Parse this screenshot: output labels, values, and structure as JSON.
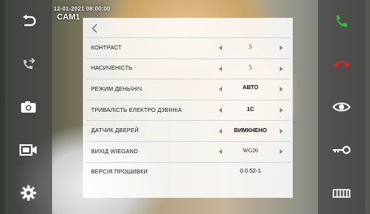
{
  "overlay": {
    "datetime": "12-01-2021  08:00:00",
    "camera": "CAM1"
  },
  "left_panel": {
    "buttons": [
      {
        "icon": "back-arrow-icon"
      },
      {
        "icon": "call-transfer-icon"
      },
      {
        "icon": "camera-icon"
      },
      {
        "icon": "record-icon"
      },
      {
        "icon": "settings-gear-icon"
      }
    ]
  },
  "right_panel": {
    "buttons": [
      {
        "icon": "answer-call-icon",
        "color": "#2fbf3a"
      },
      {
        "icon": "hang-up-icon",
        "color": "#e02020"
      },
      {
        "icon": "monitor-eye-icon"
      },
      {
        "icon": "unlock-key-icon"
      },
      {
        "icon": "gate-icon"
      }
    ]
  },
  "settings": {
    "rows": [
      {
        "label": "КОНТРАСТ",
        "value": "5"
      },
      {
        "label": "НАСИЧЕНІСТЬ",
        "value": "5"
      },
      {
        "label": "РЕЖИМ ДЕНЬ\\НІЧ",
        "value": "АВТО"
      },
      {
        "label": "ТРИВАЛІСТЬ ЕЛЕКТРО ДЗВІНКА",
        "value": "1C"
      },
      {
        "label": "ДАТЧИК ДВЕРЕЙ",
        "value": "ВИМКНЕНО"
      },
      {
        "label": "ВИХІД WIEGAND",
        "value": "WG26"
      },
      {
        "label": "ВЕРСІЯ ПРОШИВКИ",
        "value": "0.0.52-1"
      }
    ]
  }
}
